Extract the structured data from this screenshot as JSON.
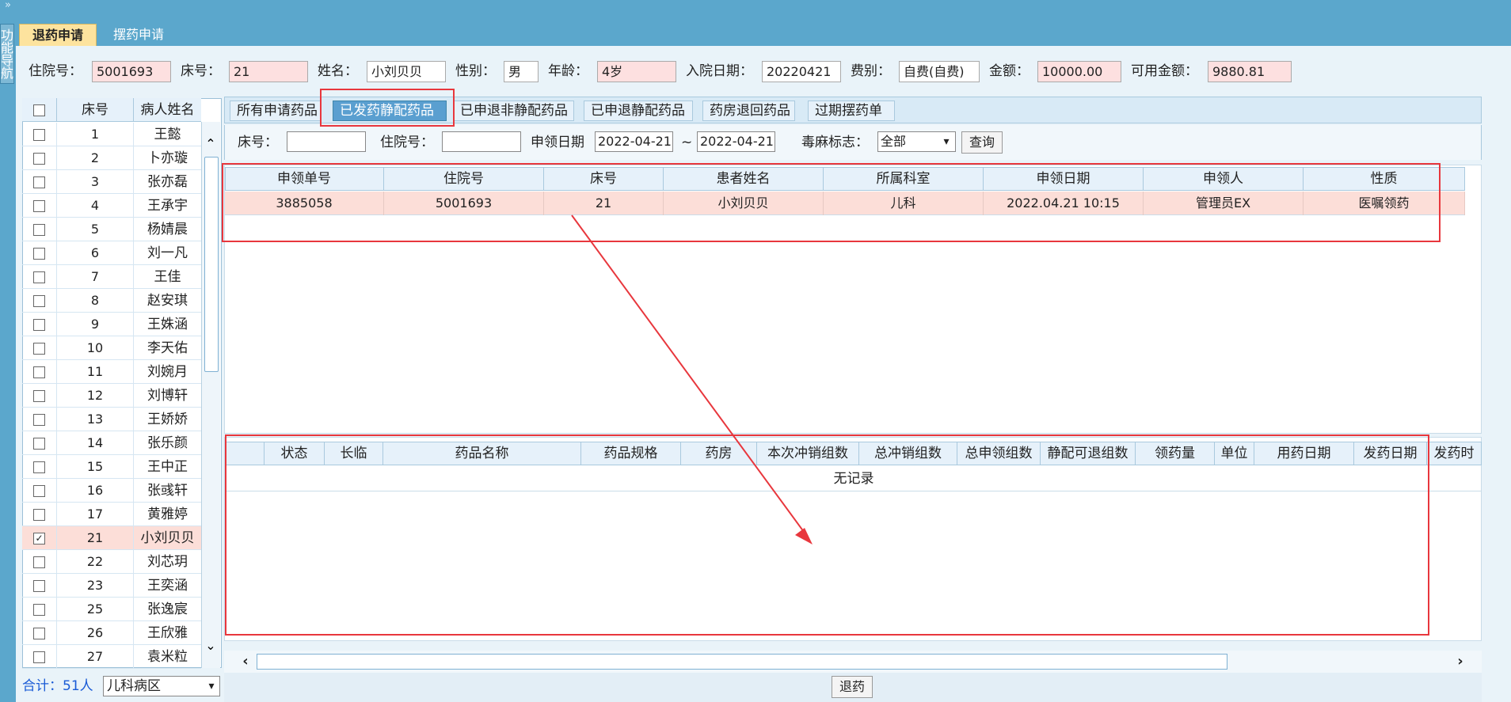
{
  "nav": {
    "toggle": "»",
    "label": "功能导航"
  },
  "top_tabs": [
    "退药申请",
    "摆药申请"
  ],
  "patient_info": {
    "admission_label": "住院号：",
    "admission_value": "5001693",
    "bed_label": "床号：",
    "bed_value": "21",
    "name_label": "姓名：",
    "name_value": "小刘贝贝",
    "gender_label": "性别：",
    "gender_value": "男",
    "age_label": "年龄：",
    "age_value": "4岁",
    "admit_date_label": "入院日期：",
    "admit_date_value": "20220421",
    "fee_label": "费别：",
    "fee_value": "自费(自费)",
    "amount_label": "金额：",
    "amount_value": "10000.00",
    "available_label": "可用金额：",
    "available_value": "9880.81"
  },
  "patient_list": {
    "headers": [
      "床号",
      "病人姓名"
    ],
    "rows": [
      {
        "bed": "1",
        "name": "王懿",
        "checked": false
      },
      {
        "bed": "2",
        "name": "卜亦璇",
        "checked": false
      },
      {
        "bed": "3",
        "name": "张亦磊",
        "checked": false
      },
      {
        "bed": "4",
        "name": "王承宇",
        "checked": false
      },
      {
        "bed": "5",
        "name": "杨婧晨",
        "checked": false
      },
      {
        "bed": "6",
        "name": "刘一凡",
        "checked": false
      },
      {
        "bed": "7",
        "name": "王佳",
        "checked": false
      },
      {
        "bed": "8",
        "name": "赵安琪",
        "checked": false
      },
      {
        "bed": "9",
        "name": "王姝涵",
        "checked": false
      },
      {
        "bed": "10",
        "name": "李天佑",
        "checked": false
      },
      {
        "bed": "11",
        "name": "刘婉月",
        "checked": false
      },
      {
        "bed": "12",
        "name": "刘博轩",
        "checked": false
      },
      {
        "bed": "13",
        "name": "王娇娇",
        "checked": false
      },
      {
        "bed": "14",
        "name": "张乐颜",
        "checked": false
      },
      {
        "bed": "15",
        "name": "王中正",
        "checked": false
      },
      {
        "bed": "16",
        "name": "张彧轩",
        "checked": false
      },
      {
        "bed": "17",
        "name": "黄雅婷",
        "checked": false
      },
      {
        "bed": "21",
        "name": "小刘贝贝",
        "checked": true
      },
      {
        "bed": "22",
        "name": "刘芯玥",
        "checked": false
      },
      {
        "bed": "23",
        "name": "王奕涵",
        "checked": false
      },
      {
        "bed": "25",
        "name": "张逸宸",
        "checked": false
      },
      {
        "bed": "26",
        "name": "王欣雅",
        "checked": false
      },
      {
        "bed": "27",
        "name": "袁米粒",
        "checked": false
      }
    ],
    "total_text": "合计：51人",
    "ward_value": "儿科病区"
  },
  "sub_tabs": [
    "所有申请药品",
    "已发药静配药品",
    "已申退非静配药品",
    "已申退静配药品",
    "药房退回药品",
    "过期摆药单"
  ],
  "filters": {
    "bed_label": "床号：",
    "bed_value": "",
    "admission_label": "住院号：",
    "admission_value": "",
    "date_label": "申领日期",
    "date_from": "2022-04-21",
    "date_sep": "~",
    "date_to": "2022-04-21",
    "narcotic_label": "毒麻标志：",
    "narcotic_value": "全部",
    "search_button": "查询"
  },
  "grid1": {
    "headers": [
      "申领单号",
      "住院号",
      "床号",
      "患者姓名",
      "所属科室",
      "申领日期",
      "申领人",
      "性质"
    ],
    "row": [
      "3885058",
      "5001693",
      "21",
      "小刘贝贝",
      "儿科",
      "2022.04.21 10:15",
      "管理员EX",
      "医嘱领药"
    ]
  },
  "grid2": {
    "headers": [
      "",
      "状态",
      "长临",
      "药品名称",
      "药品规格",
      "药房",
      "本次冲销组数",
      "总冲销组数",
      "总申领组数",
      "静配可退组数",
      "领药量",
      "单位",
      "用药日期",
      "发药日期",
      "发药时"
    ],
    "empty_text": "无记录"
  },
  "bottom": {
    "return_button": "退药"
  },
  "colors": {
    "accent": "#5ba7cc",
    "highlight": "#fcded8",
    "annotation": "#e8373d"
  }
}
